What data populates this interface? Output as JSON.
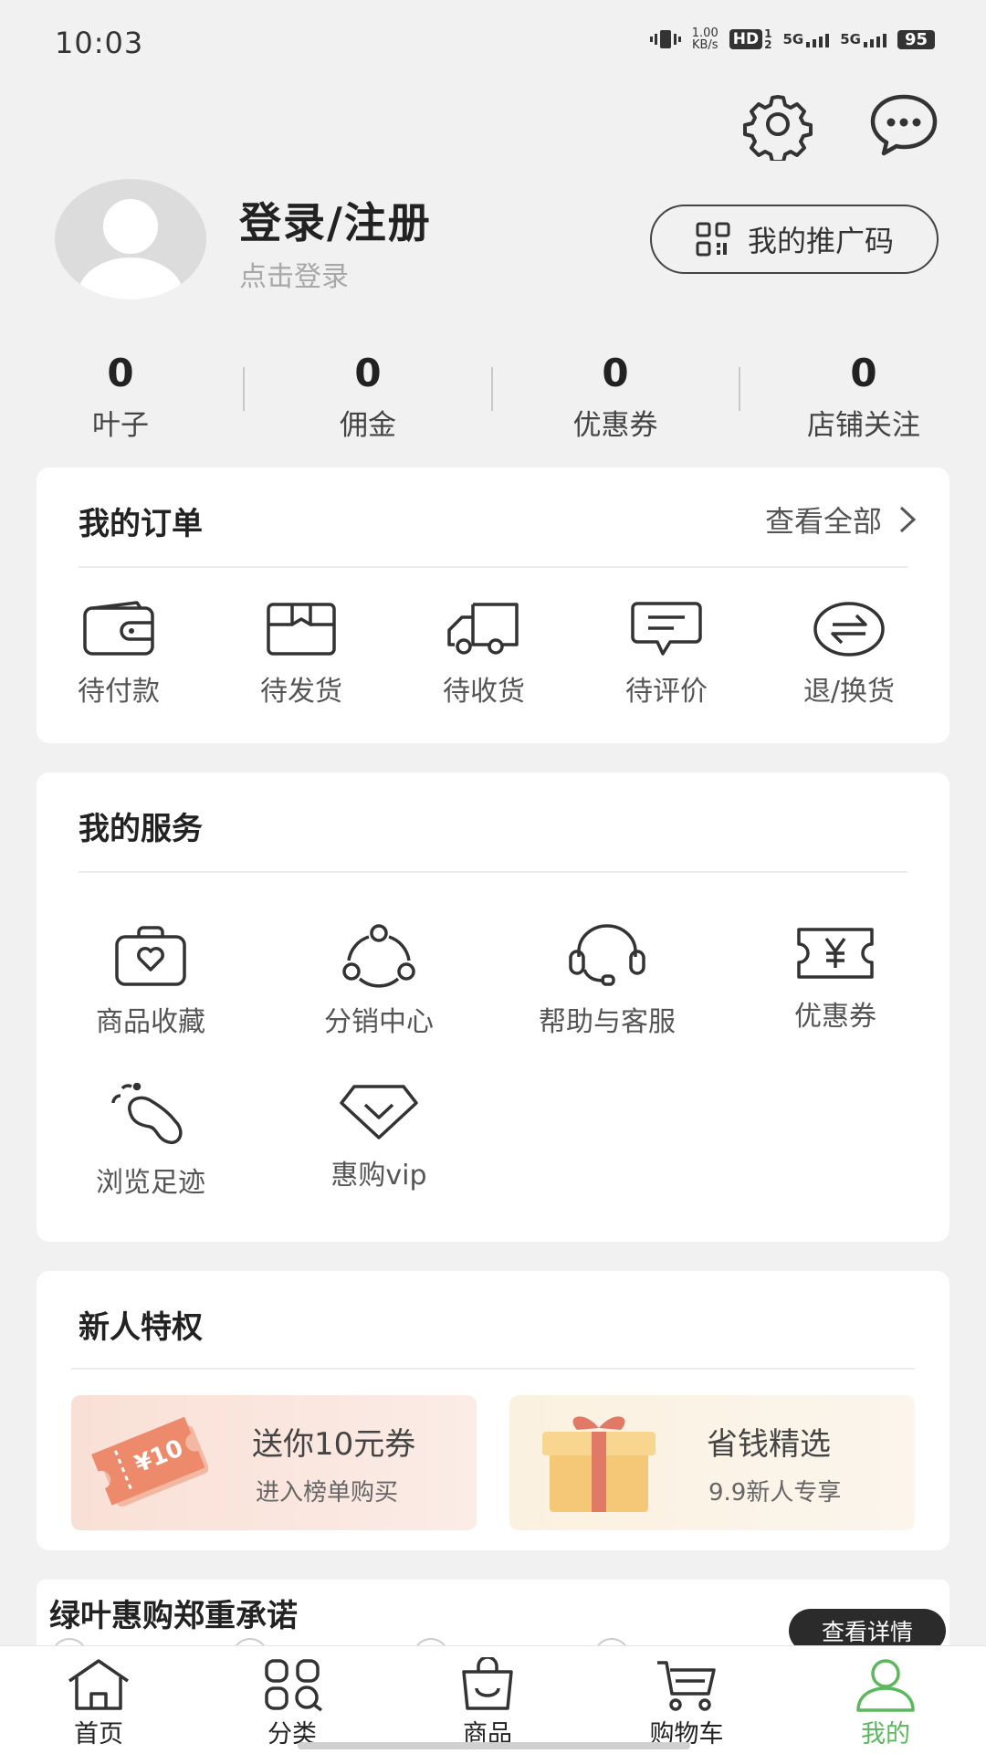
{
  "status_bar": {
    "time": "10:03",
    "net_speed_value": "1.00",
    "net_speed_unit": "KB/s",
    "hd": "HD",
    "sim1": "1",
    "sim2": "2",
    "signal1": "5G",
    "signal2": "5G",
    "battery": "95"
  },
  "header": {
    "settings_icon": "gear-icon",
    "message_icon": "chat-bubble-icon"
  },
  "profile": {
    "title": "登录/注册",
    "subtitle": "点击登录",
    "promo_code_label": "我的推广码"
  },
  "stats": [
    {
      "value": "0",
      "label": "叶子"
    },
    {
      "value": "0",
      "label": "佣金"
    },
    {
      "value": "0",
      "label": "优惠券"
    },
    {
      "value": "0",
      "label": "店铺关注"
    }
  ],
  "orders": {
    "title": "我的订单",
    "view_all": "查看全部",
    "items": [
      {
        "label": "待付款",
        "icon": "wallet-icon"
      },
      {
        "label": "待发货",
        "icon": "package-box-icon"
      },
      {
        "label": "待收货",
        "icon": "truck-icon"
      },
      {
        "label": "待评价",
        "icon": "comment-icon"
      },
      {
        "label": "退/换货",
        "icon": "exchange-icon"
      }
    ]
  },
  "services": {
    "title": "我的服务",
    "items": [
      {
        "label": "商品收藏",
        "icon": "heart-bag-icon"
      },
      {
        "label": "分销中心",
        "icon": "network-icon"
      },
      {
        "label": "帮助与客服",
        "icon": "headset-icon"
      },
      {
        "label": "优惠券",
        "icon": "coupon-icon"
      },
      {
        "label": "浏览足迹",
        "icon": "footprint-icon"
      },
      {
        "label": "惠购vip",
        "icon": "diamond-icon"
      }
    ]
  },
  "newcomer": {
    "title": "新人特权",
    "tiles": [
      {
        "title": "送你10元券",
        "subtitle": "进入榜单购买",
        "ticket_text": "¥10"
      },
      {
        "title": "省钱精选",
        "subtitle": "9.9新人专享"
      }
    ]
  },
  "promise": {
    "title": "绿叶惠购郑重承诺",
    "details_button": "查看详情"
  },
  "bottom_nav": {
    "accent_color": "#5cb85c",
    "items": [
      {
        "label": "首页",
        "icon": "home-icon"
      },
      {
        "label": "分类",
        "icon": "category-icon"
      },
      {
        "label": "商品",
        "icon": "shopping-bag-icon"
      },
      {
        "label": "购物车",
        "icon": "cart-icon"
      },
      {
        "label": "我的",
        "icon": "user-icon",
        "active": true
      }
    ]
  }
}
